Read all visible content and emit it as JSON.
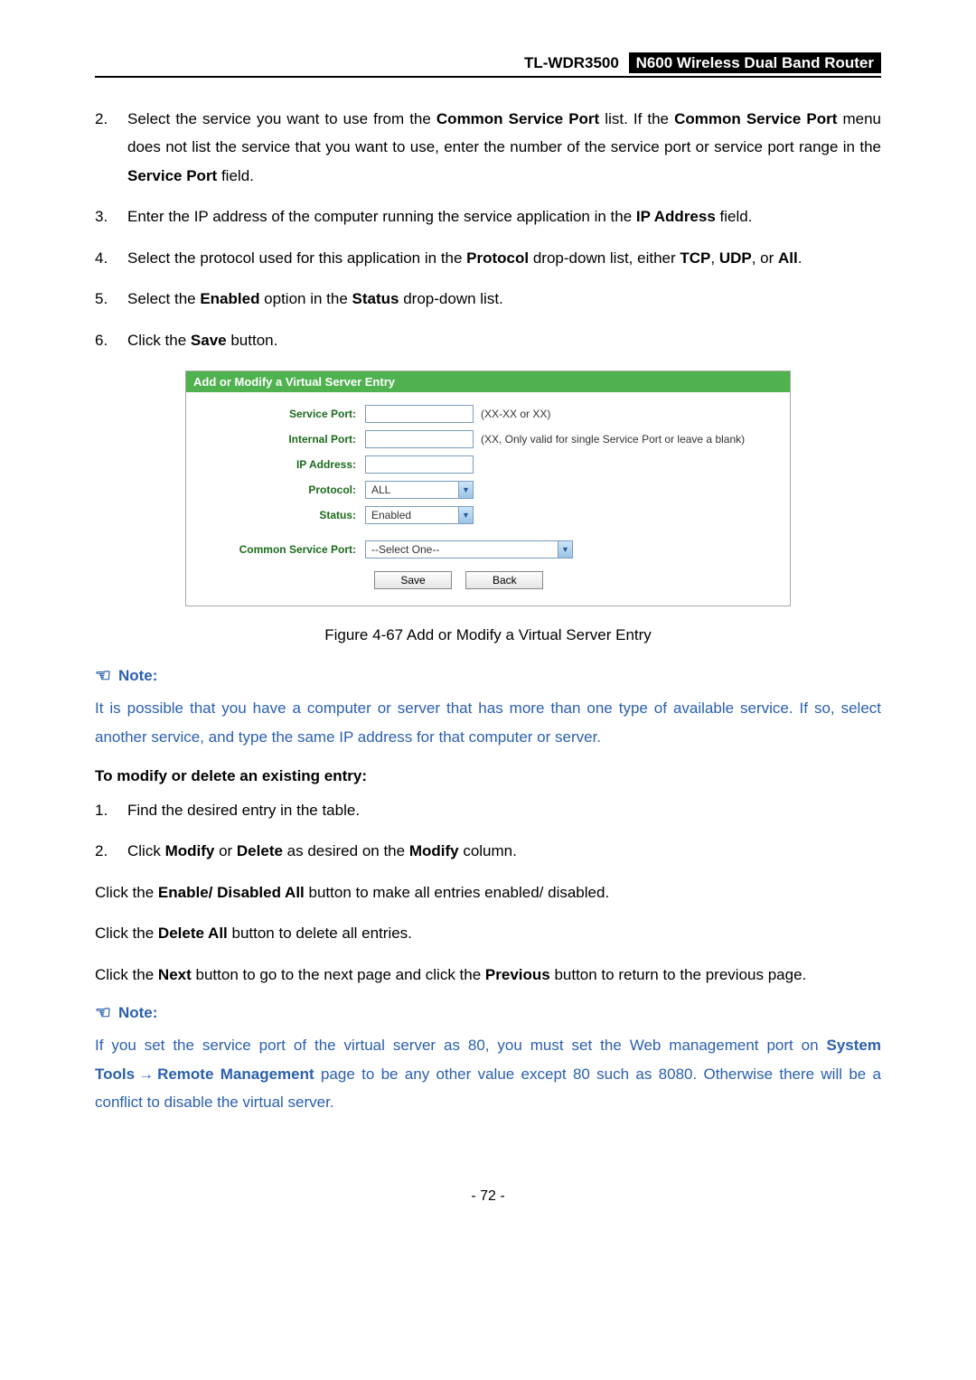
{
  "header": {
    "model": "TL-WDR3500",
    "product": "N600 Wireless Dual Band Router"
  },
  "steps1": {
    "n2": "2.",
    "t2a": "Select the service you want to use from the ",
    "t2b": "Common Service Port",
    "t2c": " list. If the ",
    "t2d": "Common Service Port",
    "t2e": " menu does not list the service that you want to use, enter the number of the service port or service port range in the ",
    "t2f": "Service Port",
    "t2g": " field.",
    "n3": "3.",
    "t3a": "Enter the IP address of the computer running the service application in the ",
    "t3b": "IP Address",
    "t3c": " field.",
    "n4": "4.",
    "t4a": "Select the protocol used for this application in the ",
    "t4b": "Protocol",
    "t4c": " drop-down list, either ",
    "t4d": "TCP",
    "t4e": ", ",
    "t4f": "UDP",
    "t4g": ", or ",
    "t4h": "All",
    "t4i": ".",
    "n5": "5.",
    "t5a": "Select the ",
    "t5b": "Enabled",
    "t5c": " option in the ",
    "t5d": "Status",
    "t5e": " drop-down list.",
    "n6": "6.",
    "t6a": "Click the ",
    "t6b": "Save",
    "t6c": " button."
  },
  "figure": {
    "title": "Add or Modify a Virtual Server Entry",
    "labels": {
      "servicePort": "Service Port:",
      "internalPort": "Internal Port:",
      "ipAddress": "IP Address:",
      "protocol": "Protocol:",
      "status": "Status:",
      "commonServicePort": "Common Service Port:"
    },
    "hints": {
      "servicePort": "(XX-XX or XX)",
      "internalPort": "(XX, Only valid for single Service Port or leave a blank)"
    },
    "values": {
      "protocol": "ALL",
      "status": "Enabled",
      "commonServicePort": "--Select One--"
    },
    "buttons": {
      "save": "Save",
      "back": "Back"
    },
    "caption": "Figure 4-67 Add or Modify a Virtual Server Entry"
  },
  "note1": {
    "label": "Note:",
    "text": "It is possible that you have a computer or server that has more than one type of available service. If so, select another service, and type the same IP address for that computer or server."
  },
  "section2": {
    "head": "To modify or delete an existing entry:",
    "n1": "1.",
    "t1": "Find the desired entry in the table.",
    "n2": "2.",
    "t2a": "Click ",
    "t2b": "Modify",
    "t2c": " or ",
    "t2d": "Delete",
    "t2e": " as desired on the ",
    "t2f": "Modify",
    "t2g": " column."
  },
  "paras": {
    "p1a": "Click the ",
    "p1b": "Enable/ Disabled All",
    "p1c": " button to make all entries enabled/ disabled.",
    "p2a": "Click the ",
    "p2b": "Delete All",
    "p2c": " button to delete all entries.",
    "p3a": "Click the ",
    "p3b": "Next",
    "p3c": " button to go to the next page and click the ",
    "p3d": "Previous",
    "p3e": " button to return to the previous page."
  },
  "note2": {
    "label": "Note:",
    "a": "If you set the service port of the virtual server as 80, you must set the Web management port on ",
    "b": "System Tools",
    "arrow": "→",
    "c": "Remote Management",
    "d": " page to be any other value except 80 such as 8080. Otherwise there will be a conflict to disable the virtual server."
  },
  "pagenum": "- 72 -"
}
